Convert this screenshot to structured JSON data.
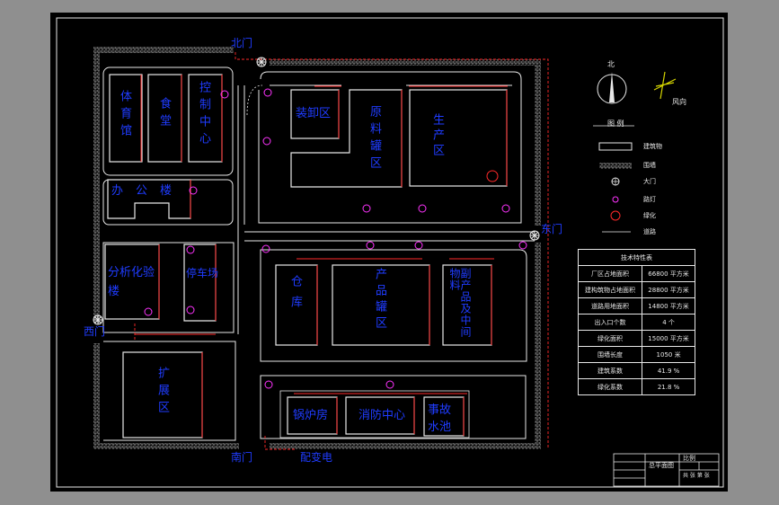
{
  "gates": {
    "north": "北门",
    "east": "东门",
    "west": "西门",
    "south": "南门"
  },
  "zones": {
    "gym": "体育馆",
    "canteen": "食堂",
    "control_center": "控制中心",
    "office": "办公楼",
    "analysis": "分析化验楼",
    "parking": "停车场",
    "expansion": "扩展区",
    "loading": "装卸区",
    "raw_tank": "原料罐区",
    "production": "生产区",
    "warehouse": "仓库",
    "product_tank": "产品罐区",
    "by_product": "副产品及中间物料",
    "boiler": "锅炉房",
    "fire_center": "消防中心",
    "accident_pool": "事故水池",
    "substation": "配变电"
  },
  "compass": {
    "north": "北",
    "wind_label": "风向"
  },
  "legend": {
    "title": "图  例",
    "items": [
      "建筑物",
      "围墙",
      "大门",
      "路灯",
      "绿化",
      "道路"
    ]
  },
  "spec_table": {
    "title": "技术特性表",
    "rows": [
      {
        "label": "厂区占地面积",
        "value": "66800 平方米"
      },
      {
        "label": "建构筑物占地面积",
        "value": "28800 平方米"
      },
      {
        "label": "道路用地面积",
        "value": "14800 平方米"
      },
      {
        "label": "出入口个数",
        "value": "4   个"
      },
      {
        "label": "绿化面积",
        "value": "15000 平方米"
      },
      {
        "label": "围墙长度",
        "value": "1050    米"
      },
      {
        "label": "建筑系数",
        "value": "41.9  %"
      },
      {
        "label": "绿化系数",
        "value": "21.8  %"
      }
    ]
  },
  "title_block": {
    "drawing_name": "总平面图",
    "scale_label": "比例",
    "sheet_label": "共  张  第  张"
  },
  "colors": {
    "background": "#000000",
    "frame": "#e8e8e8",
    "label": "#1f3cff",
    "red": "#ff2a2a",
    "magenta": "#ff33ff"
  }
}
